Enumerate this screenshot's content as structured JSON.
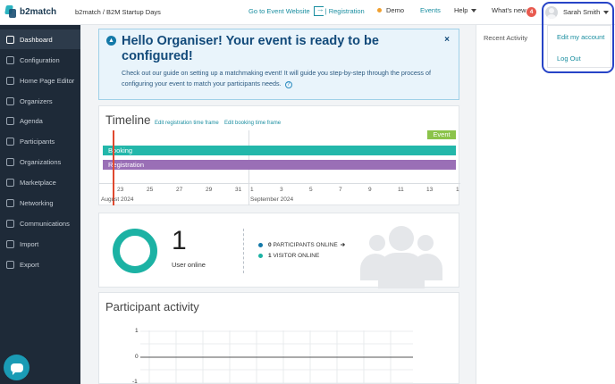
{
  "brand": {
    "name": "b2match"
  },
  "header": {
    "breadcrumb": "b2match / B2M Startup Days",
    "go_to_event": "Go to Event Website",
    "registration": "| Registration",
    "demo": "Demo",
    "events": "Events",
    "help": "Help",
    "whats_new": "What's new",
    "whats_new_count": "4",
    "user_name": "Sarah Smith"
  },
  "user_menu": {
    "items": [
      "Edit my account",
      "Log Out"
    ]
  },
  "sidebar": {
    "items": [
      {
        "label": "Dashboard",
        "icon": "dashboard-icon",
        "active": true
      },
      {
        "label": "Configuration",
        "icon": "configuration-icon"
      },
      {
        "label": "Home Page Editor",
        "icon": "home-page-editor-icon"
      },
      {
        "label": "Organizers",
        "icon": "organizers-icon"
      },
      {
        "label": "Agenda",
        "icon": "agenda-icon"
      },
      {
        "label": "Participants",
        "icon": "participants-icon"
      },
      {
        "label": "Organizations",
        "icon": "organizations-icon"
      },
      {
        "label": "Marketplace",
        "icon": "marketplace-icon"
      },
      {
        "label": "Networking",
        "icon": "networking-icon"
      },
      {
        "label": "Communications",
        "icon": "communications-icon"
      },
      {
        "label": "Import",
        "icon": "import-icon"
      },
      {
        "label": "Export",
        "icon": "export-icon"
      }
    ]
  },
  "alert": {
    "title": "Hello Organiser! Your event is ready to be configured!",
    "body": "Check out our guide on setting up a matchmaking event! It will guide you step-by-step through the process of configuring your event to match your participants needs.",
    "close": "×",
    "help_glyph": "?"
  },
  "timeline": {
    "title": "Timeline",
    "edit_registration": "Edit registration time frame",
    "edit_booking": "Edit booking time frame",
    "event_label": "Event",
    "booking_label": "Booking",
    "registration_label": "Registration",
    "ticks": [
      "23",
      "25",
      "27",
      "29",
      "31",
      "1",
      "3",
      "5",
      "7",
      "9",
      "11",
      "13",
      "1"
    ],
    "months": [
      "August 2024",
      "September 2024"
    ]
  },
  "online": {
    "count": "1",
    "label": "User online",
    "participants_count": "0",
    "participants_label": "PARTICIPANTS ONLINE",
    "visitors_count": "1",
    "visitors_label": "VISITOR ONLINE",
    "colors": {
      "participants": "#1479a8",
      "visitors": "#1cb2a4"
    }
  },
  "activity": {
    "title": "Participant activity",
    "y_ticks": [
      "1",
      "0",
      "-1"
    ]
  },
  "recent": {
    "title": "Recent Activity"
  },
  "colors": {
    "sidebar_bg": "#1e2a38",
    "accent_teal": "#1a8ea0",
    "booking": "#23b7aa",
    "registration": "#9a6fb6",
    "event": "#8bc34a",
    "today_marker": "#e0492f",
    "dropdown_highlight": "#2744c7"
  }
}
